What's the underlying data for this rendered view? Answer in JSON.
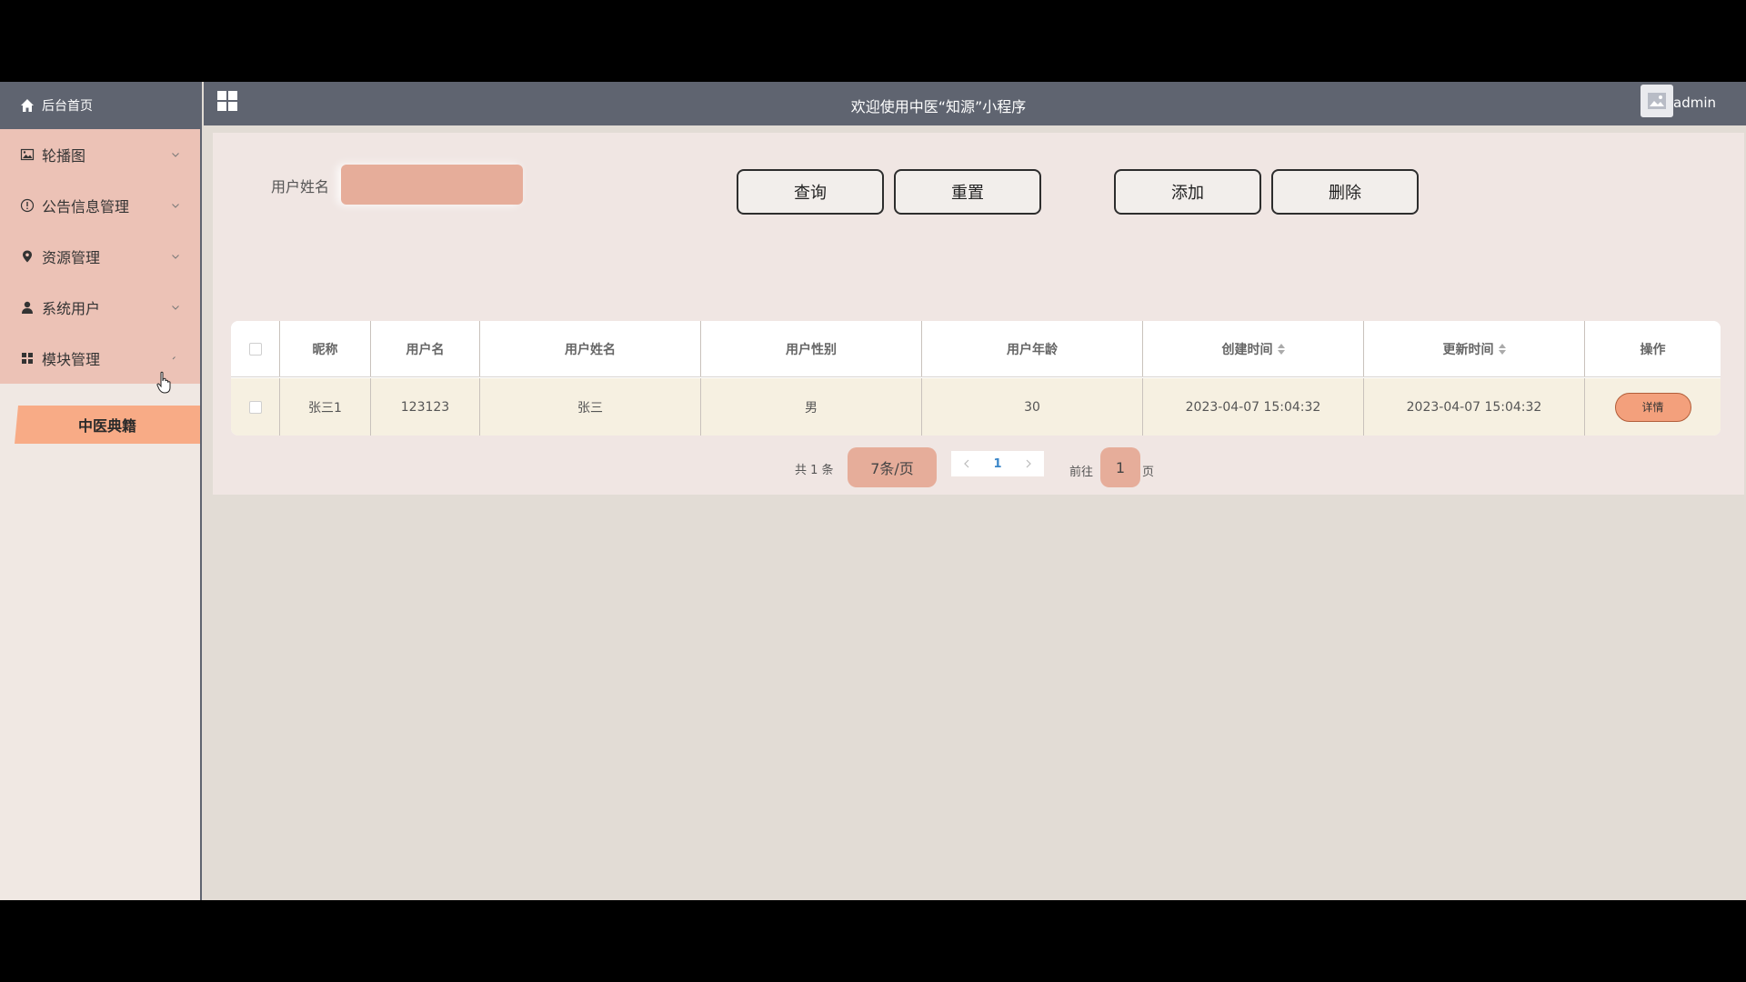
{
  "sidebar": {
    "home_label": "后台首页",
    "items": [
      {
        "label": "轮播图",
        "icon": "image-icon"
      },
      {
        "label": "公告信息管理",
        "icon": "info-circle-icon"
      },
      {
        "label": "资源管理",
        "icon": "location-pin-icon"
      },
      {
        "label": "系统用户",
        "icon": "user-icon"
      },
      {
        "label": "模块管理",
        "icon": "grid-icon"
      }
    ],
    "active_sub_item": "中医典籍"
  },
  "header": {
    "title": "欢迎使用中医“知源”小程序",
    "user": "admin"
  },
  "search": {
    "label": "用户姓名",
    "value": ""
  },
  "buttons": {
    "query": "查询",
    "reset": "重置",
    "add": "添加",
    "delete": "删除"
  },
  "table": {
    "columns": [
      "昵称",
      "用户名",
      "用户姓名",
      "用户性别",
      "用户年龄",
      "创建时间",
      "更新时间",
      "操作"
    ],
    "rows": [
      {
        "nickname": "张三1",
        "username": "123123",
        "name": "张三",
        "gender": "男",
        "age": "30",
        "created": "2023-04-07 15:04:32",
        "updated": "2023-04-07 15:04:32",
        "action": "详情"
      }
    ]
  },
  "pagination": {
    "total": "共 1 条",
    "page_size": "7条/页",
    "current_page": "1",
    "goto_label": "前往",
    "goto_value": "1",
    "page_unit": "页"
  },
  "colors": {
    "header_bg": "#5f6470",
    "accent": "#f8ab86",
    "input_bg": "#e6ad9a"
  }
}
